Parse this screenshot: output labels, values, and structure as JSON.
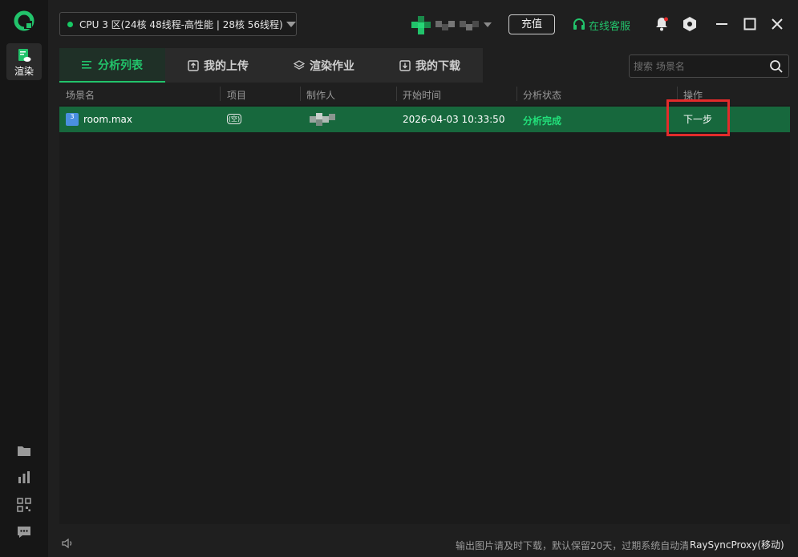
{
  "rail": {
    "active_label": "渲染"
  },
  "header": {
    "zone": "CPU 3 区(24核 48线程-高性能 | 28核 56线程)",
    "recharge": "充值",
    "service": "在线客服"
  },
  "tabs": [
    {
      "label": "分析列表",
      "icon": "list-icon"
    },
    {
      "label": "我的上传",
      "icon": "upload-icon"
    },
    {
      "label": "渲染作业",
      "icon": "layers-icon"
    },
    {
      "label": "我的下载",
      "icon": "download-icon"
    }
  ],
  "search": {
    "placeholder": "搜索 场景名"
  },
  "table": {
    "columns": [
      "场景名",
      "项目",
      "制作人",
      "开始时间",
      "分析状态",
      "操作"
    ],
    "rows": [
      {
        "scene": "room.max",
        "project": "(空)",
        "start_time": "2026-04-03 10:33:50",
        "status": "分析完成",
        "action": "下一步"
      }
    ]
  },
  "footer": {
    "notice": "输出图片请及时下载，默认保留20天，过期系统自动清",
    "proxy": "RaySyncProxy(移动)"
  },
  "colors": {
    "accent": "#22c36b",
    "row_selected": "#17683d",
    "highlight_box": "#e32b2b"
  }
}
